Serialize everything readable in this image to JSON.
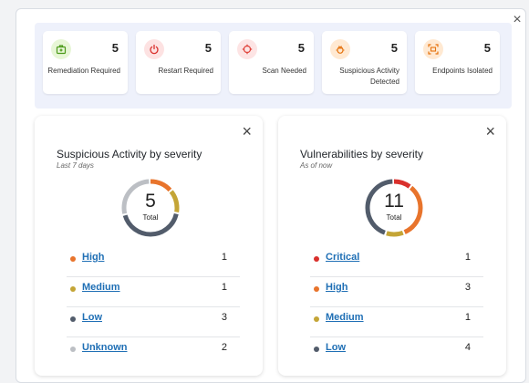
{
  "close_label": "×",
  "stats": [
    {
      "value": "5",
      "label": "Remediation Required",
      "icon": "briefcase-plus-icon",
      "icon_bg": "#e7f6d6",
      "icon_color": "#4a9a18"
    },
    {
      "value": "5",
      "label": "Restart Required",
      "icon": "power-icon",
      "icon_bg": "#fde2e2",
      "icon_color": "#d9302c"
    },
    {
      "value": "5",
      "label": "Scan Needed",
      "icon": "crosshair-icon",
      "icon_bg": "#fde4e4",
      "icon_color": "#e0443c"
    },
    {
      "value": "5",
      "label": "Suspicious Activity Detected",
      "icon": "bug-icon",
      "icon_bg": "#ffe9d2",
      "icon_color": "#e5730f"
    },
    {
      "value": "5",
      "label": "Endpoints Isolated",
      "icon": "isolate-icon",
      "icon_bg": "#ffe9d2",
      "icon_color": "#e5730f"
    }
  ],
  "cards": [
    {
      "title": "Suspicious Activity by severity",
      "subtitle": "Last 7 days",
      "total": "5",
      "total_label": "Total",
      "rows": [
        {
          "label": "High",
          "count": "1",
          "value": 1,
          "color": "#e8742c"
        },
        {
          "label": "Medium",
          "count": "1",
          "value": 1,
          "color": "#c4a536"
        },
        {
          "label": "Low",
          "count": "3",
          "value": 3,
          "color": "#525c6b"
        },
        {
          "label": "Unknown",
          "count": "2",
          "value": 2,
          "color": "#bcbfc4"
        }
      ]
    },
    {
      "title": "Vulnerabilities by severity",
      "subtitle": "As of now",
      "total": "11",
      "total_label": "Total",
      "rows": [
        {
          "label": "Critical",
          "count": "1",
          "value": 1,
          "color": "#d9302c"
        },
        {
          "label": "High",
          "count": "3",
          "value": 3,
          "color": "#e8742c"
        },
        {
          "label": "Medium",
          "count": "1",
          "value": 1,
          "color": "#c4a536"
        },
        {
          "label": "Low",
          "count": "4",
          "value": 4,
          "color": "#525c6b"
        }
      ]
    }
  ]
}
